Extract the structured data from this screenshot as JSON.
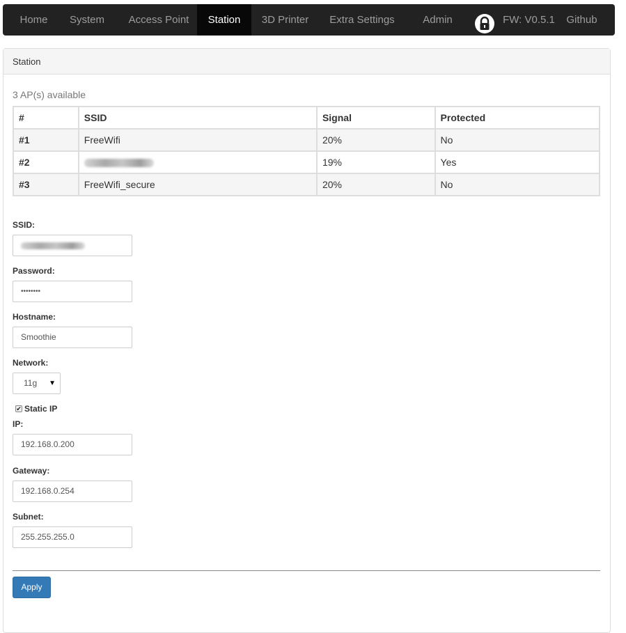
{
  "nav": {
    "items": [
      "Home",
      "System",
      "Access Point",
      "Station",
      "3D Printer",
      "Extra Settings",
      "Admin"
    ],
    "active": "Station",
    "lock_icon": "lock-icon",
    "firmware": "FW: V0.5.1",
    "github": "Github"
  },
  "panel": {
    "title": "Station",
    "ap_count": "3 AP(s) available",
    "table": {
      "headers": [
        "#",
        "SSID",
        "Signal",
        "Protected"
      ],
      "rows": [
        {
          "num": "#1",
          "ssid": "FreeWifi",
          "signal": "20%",
          "protected": "No"
        },
        {
          "num": "#2",
          "ssid": "",
          "signal": "19%",
          "protected": "Yes"
        },
        {
          "num": "#3",
          "ssid": "FreeWifi_secure",
          "signal": "20%",
          "protected": "No"
        }
      ]
    }
  },
  "form": {
    "ssid_label": "SSID:",
    "ssid_value": "",
    "password_label": "Password:",
    "password_value": "••••••••",
    "hostname_label": "Hostname:",
    "hostname_value": "Smoothie",
    "network_label": "Network:",
    "network_value": "11g",
    "static_ip_label": "Static IP",
    "static_ip_checked": true,
    "ip_label": "IP:",
    "ip_value": "192.168.0.200",
    "gateway_label": "Gateway:",
    "gateway_value": "192.168.0.254",
    "subnet_label": "Subnet:",
    "subnet_value": "255.255.255.0",
    "apply_label": "Apply"
  },
  "colors": {
    "navbar": "#222222",
    "nav_active": "#080808",
    "primary_button": "#337ab7"
  }
}
